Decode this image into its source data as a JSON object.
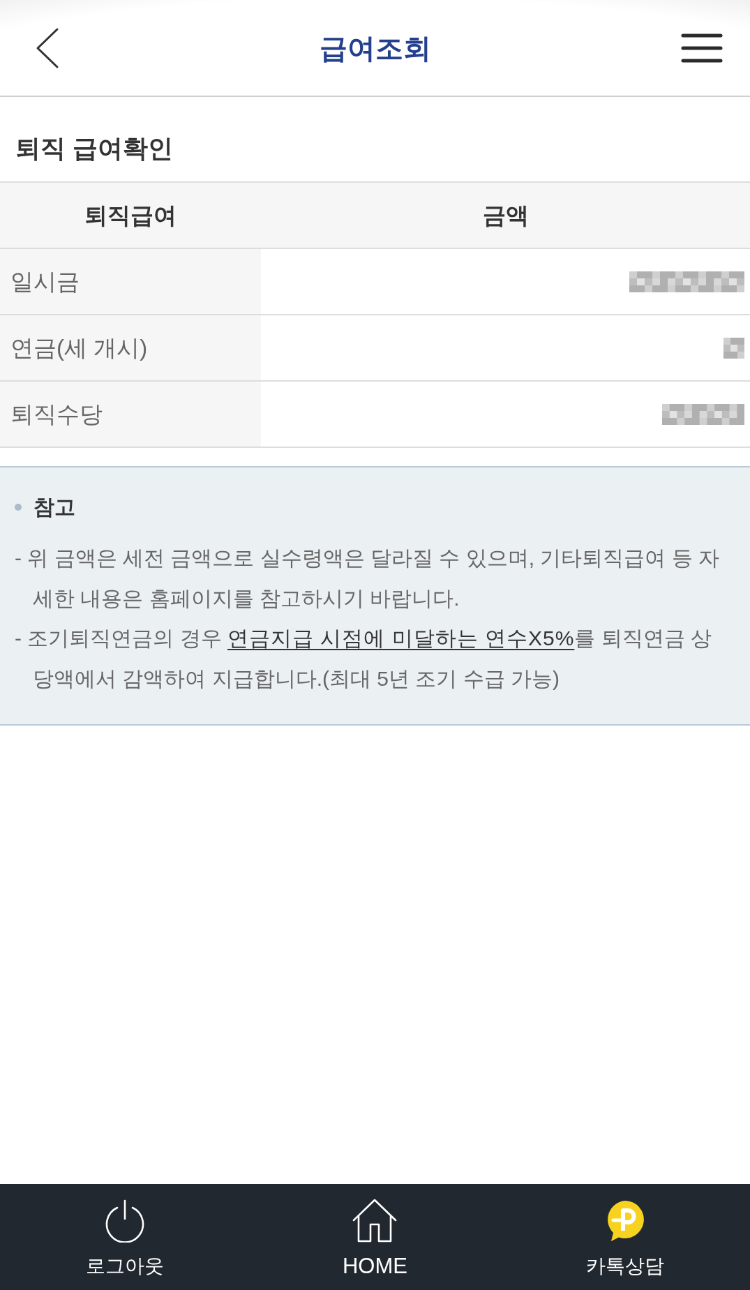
{
  "header": {
    "title": "급여조회"
  },
  "section": {
    "title": "퇴직 급여확인"
  },
  "table": {
    "columns": [
      "퇴직급여",
      "금액"
    ],
    "rows": [
      {
        "label": "일시금",
        "masked": true
      },
      {
        "label": "연금(세 개시)",
        "masked": true
      },
      {
        "label": "퇴직수당",
        "masked": true
      }
    ]
  },
  "note": {
    "title": "참고",
    "items": [
      {
        "text": "- 위 금액은 세전 금액으로 실수령액은 달라질 수 있으며, 기타퇴직급여 등 자세한 내용은 홈페이지를 참고하시기 바랍니다."
      },
      {
        "text": "- 조기퇴직연금의 경우 ",
        "link": "연금지급 시점에 미달하는 연수X5%",
        "after": "를 퇴직연금 상당액에서 감액하여 지급합니다.(최대 5년 조기 수급 가능)"
      }
    ]
  },
  "bottom_nav": [
    {
      "label": "로그아웃",
      "kind": "power"
    },
    {
      "label": "HOME",
      "kind": "home"
    },
    {
      "label": "카톡상담",
      "kind": "chat"
    }
  ]
}
